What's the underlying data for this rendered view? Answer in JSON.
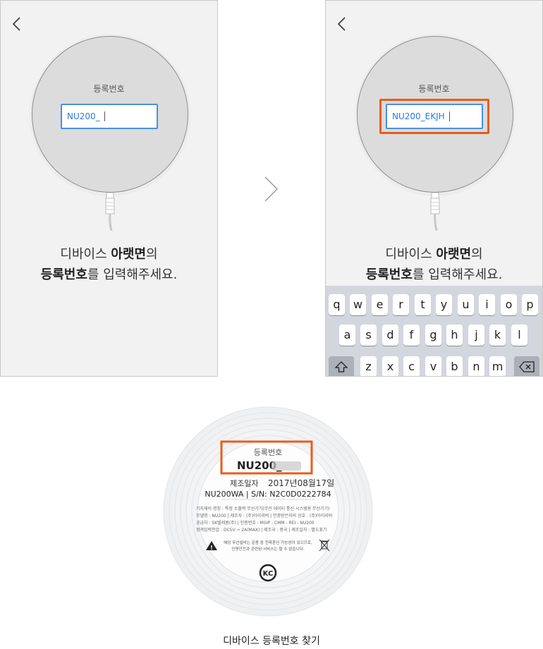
{
  "step1": {
    "disc_label": "등록번호",
    "input_value": "NU200_",
    "instruction_line1_normal": "디바이스 ",
    "instruction_line1_bold": "아랫면",
    "instruction_line1_suffix": "의",
    "instruction_line2_bold": "등록번호",
    "instruction_line2_suffix": "를 입력해주세요."
  },
  "step2": {
    "disc_label": "등록번호",
    "input_value": "NU200_EKJH",
    "instruction_line1_normal": "디바이스 ",
    "instruction_line1_bold": "아랫면",
    "instruction_line1_suffix": "의",
    "instruction_line2_bold": "등록번호",
    "instruction_line2_suffix": "를 입력해주세요.",
    "keyboard": {
      "row1": [
        "q",
        "w",
        "e",
        "r",
        "t",
        "y",
        "u",
        "i",
        "o",
        "p"
      ],
      "row2": [
        "a",
        "s",
        "d",
        "f",
        "g",
        "h",
        "j",
        "k",
        "l"
      ],
      "row3": [
        "z",
        "x",
        "c",
        "v",
        "b",
        "n",
        "m"
      ],
      "shift_icon": "shift-icon",
      "backspace_icon": "backspace-icon"
    }
  },
  "device_label": {
    "reg_title": "등록번호",
    "reg_value": "NU200_",
    "date_prefix": "제조일자",
    "date_value": "2017년08월17일",
    "model_line": "NU200WA | S/N: N2C0D0222784",
    "fine_print": [
      "기자재의 명칭 : 특정 소출력 무선기기(무선 데이터 통신 시스템용 무선기기)",
      "모델명 : NU200 | 제조자 : (주)아이리버 | 인증받은자의 상호 : (주)아이리버",
      "공급자 : SK텔레콤(주) | 인증번호 : MSIP - CMM - REI - NU200",
      "정격입력전압 : DC5V ⎓ 2A(MAX) | 제조국 : 중국 | 제조일자 : 별도표기"
    ],
    "warning": [
      "해당 무선설비는 운용 중 전파혼신 가능성이 있으므로,",
      "인명안전과 관련된 서비스는 할 수 없습니다."
    ],
    "kc_mark": "KC"
  },
  "caption": "디바이스 등록번호 찾기",
  "colors": {
    "accent_blue": "#4a90e2",
    "highlight_orange": "#ec5b19"
  }
}
